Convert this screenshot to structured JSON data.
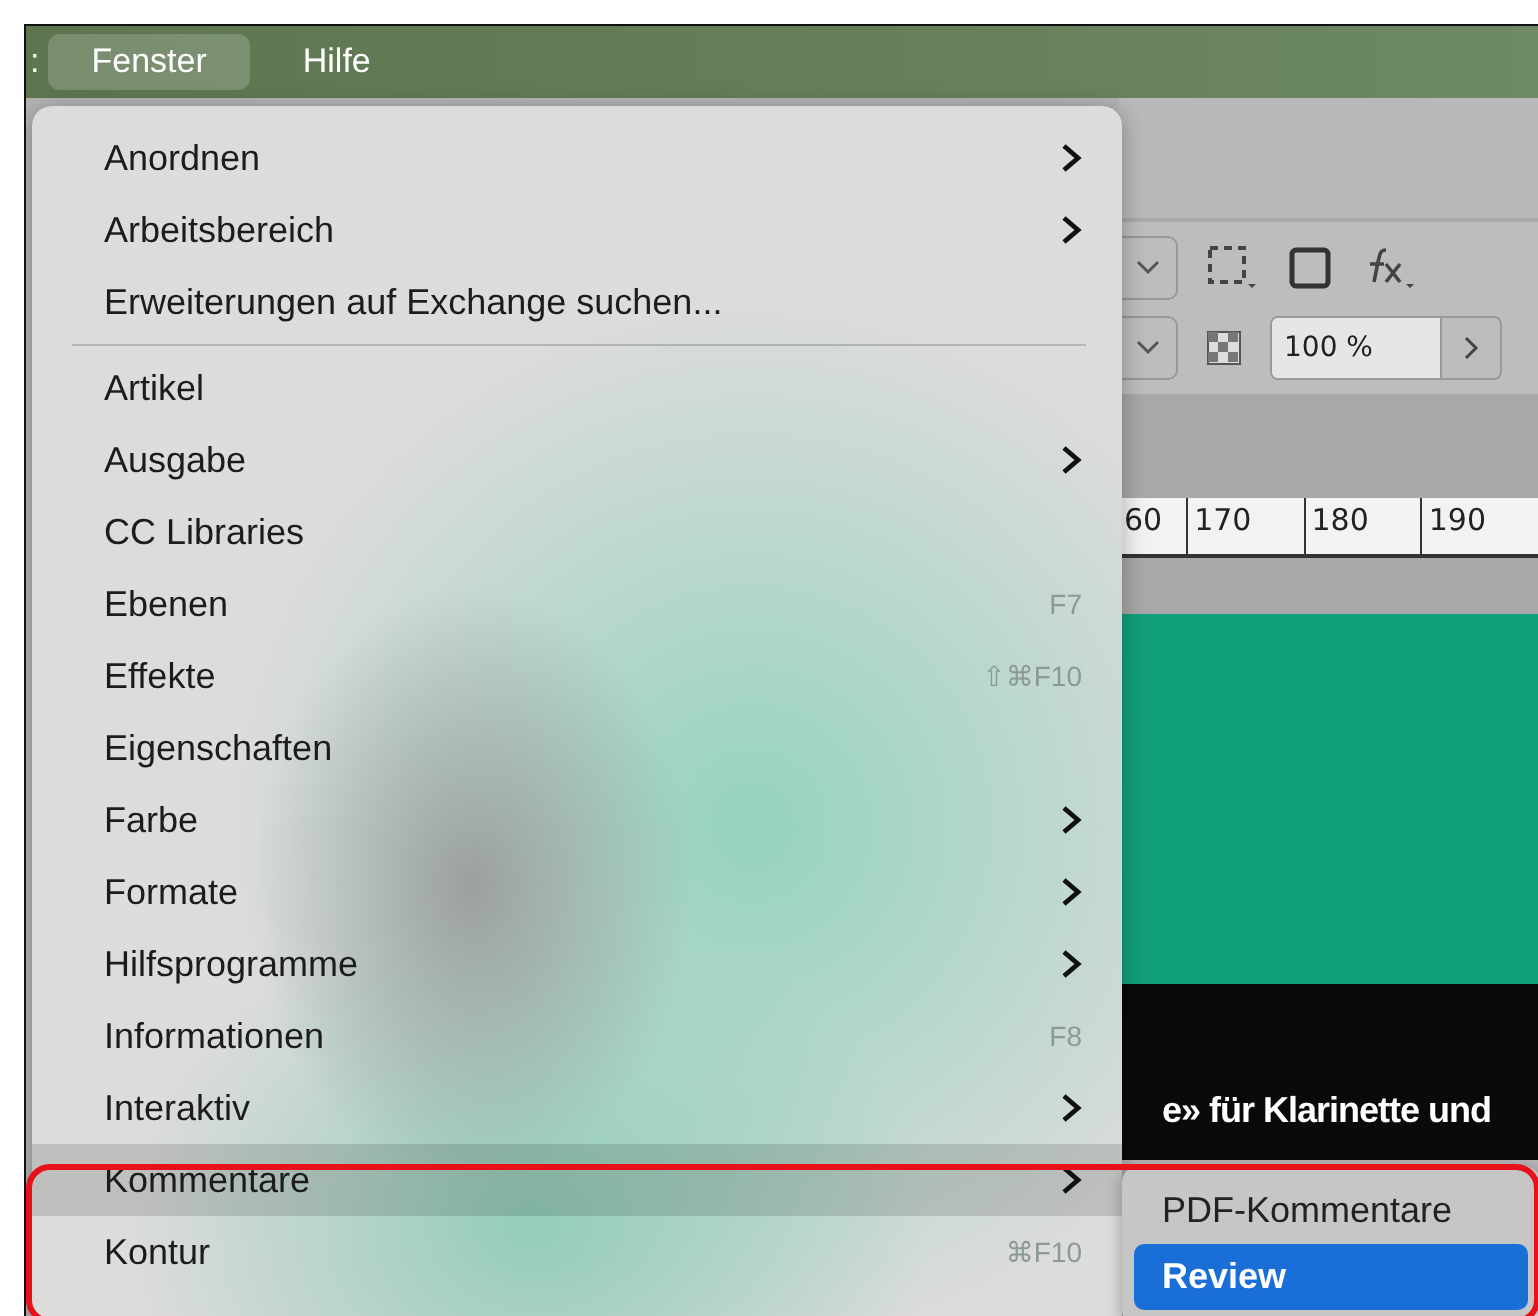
{
  "menu_bar": {
    "items": [
      {
        "label": ":",
        "selected": false
      },
      {
        "label": "Fenster",
        "selected": true
      },
      {
        "label": "Hilfe",
        "selected": false
      }
    ]
  },
  "background_app": {
    "opacity_field": "100 %",
    "ruler_labels": [
      "60",
      "170",
      "180",
      "190"
    ],
    "canvas_text": "e» für Klarinette und"
  },
  "menu": {
    "items": [
      {
        "kind": "item",
        "label": "Anordnen",
        "submenu": true,
        "selected": false
      },
      {
        "kind": "item",
        "label": "Arbeitsbereich",
        "submenu": true,
        "selected": false
      },
      {
        "kind": "item",
        "label": "Erweiterungen auf Exchange suchen...",
        "submenu": false,
        "selected": false
      },
      {
        "kind": "separator"
      },
      {
        "kind": "item",
        "label": "Artikel",
        "submenu": false,
        "selected": false
      },
      {
        "kind": "item",
        "label": "Ausgabe",
        "submenu": true,
        "selected": false
      },
      {
        "kind": "item",
        "label": "CC Libraries",
        "submenu": false,
        "selected": false
      },
      {
        "kind": "item",
        "label": "Ebenen",
        "shortcut": "F7",
        "submenu": false,
        "selected": false
      },
      {
        "kind": "item",
        "label": "Effekte",
        "shortcut": "⇧⌘F10",
        "submenu": false,
        "selected": false
      },
      {
        "kind": "item",
        "label": "Eigenschaften",
        "submenu": false,
        "selected": false
      },
      {
        "kind": "item",
        "label": "Farbe",
        "submenu": true,
        "selected": false
      },
      {
        "kind": "item",
        "label": "Formate",
        "submenu": true,
        "selected": false
      },
      {
        "kind": "item",
        "label": "Hilfsprogramme",
        "submenu": true,
        "selected": false
      },
      {
        "kind": "item",
        "label": "Informationen",
        "shortcut": "F8",
        "submenu": false,
        "selected": false
      },
      {
        "kind": "item",
        "label": "Interaktiv",
        "submenu": true,
        "selected": false
      },
      {
        "kind": "item",
        "label": "Kommentare",
        "submenu": true,
        "selected": true
      },
      {
        "kind": "item",
        "label": "Kontur",
        "shortcut": "⌘F10",
        "submenu": false,
        "selected": false
      }
    ]
  },
  "submenu": {
    "items": [
      {
        "label": "PDF-Kommentare",
        "selected": false
      },
      {
        "label": "Review",
        "selected": true
      }
    ]
  },
  "annotation": {
    "highlight": true
  }
}
